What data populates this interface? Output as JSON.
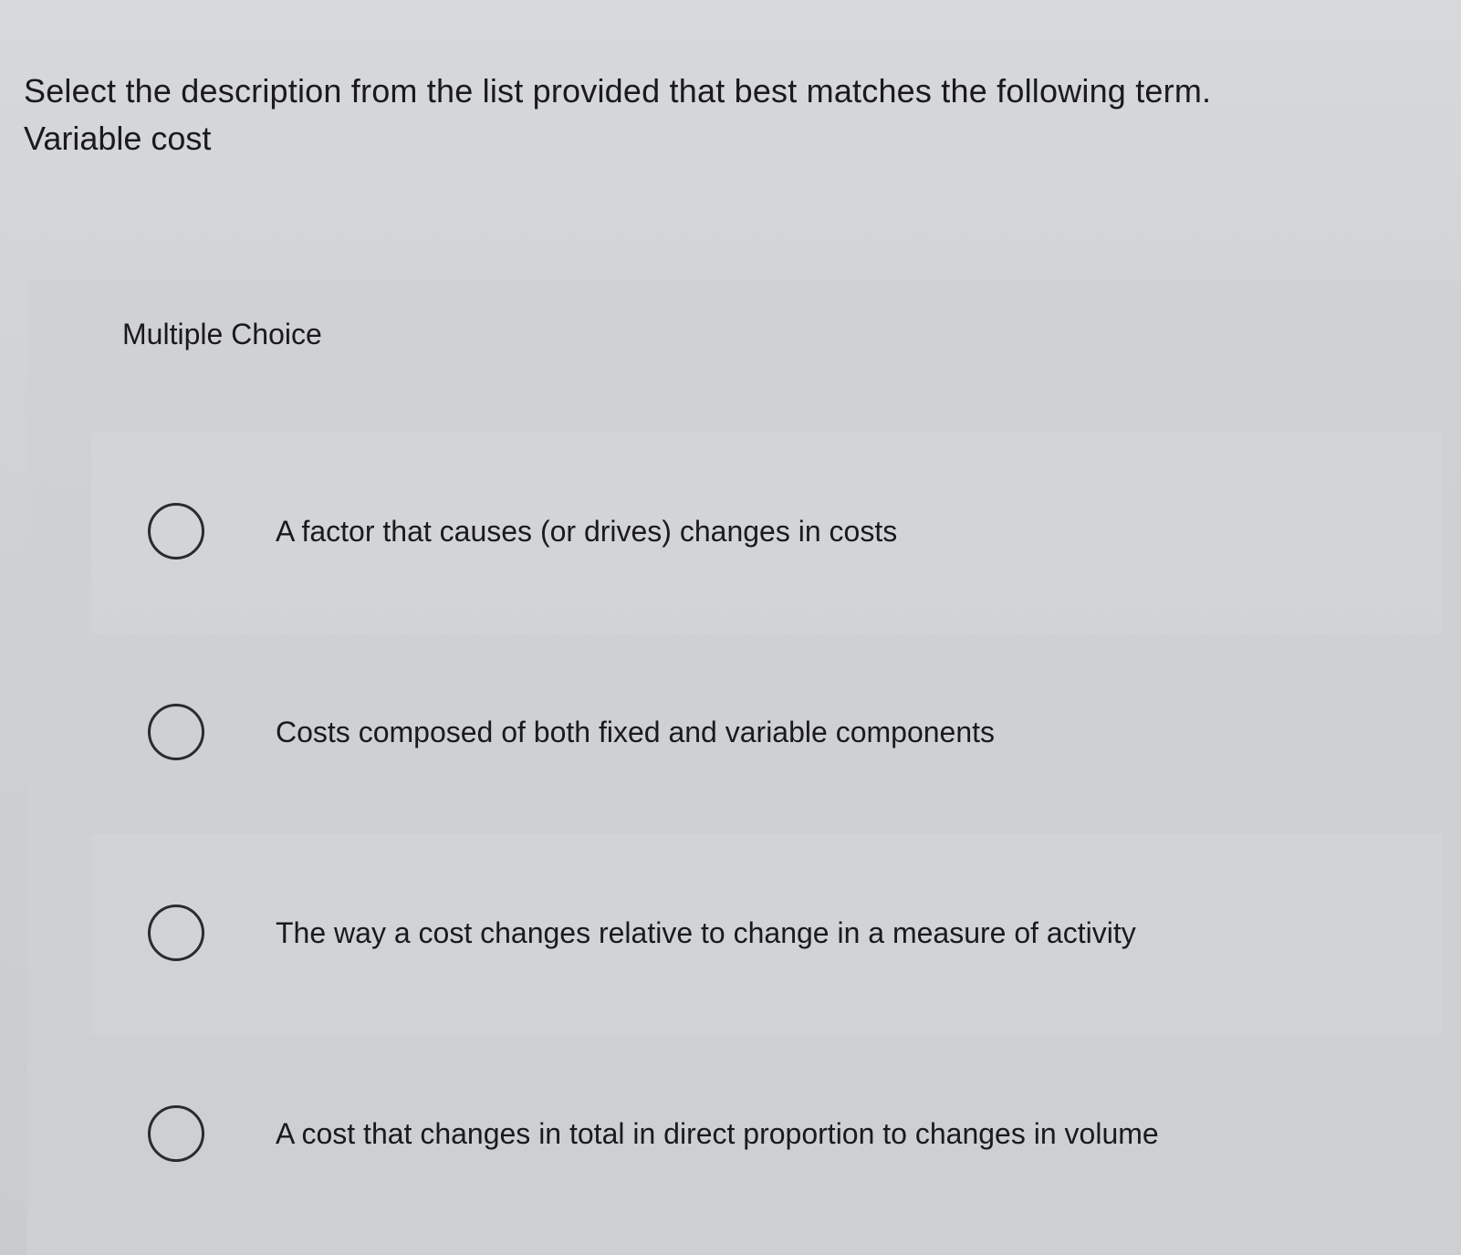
{
  "question": {
    "prompt": "Select the description from the list provided that best matches the following term.",
    "term": "Variable cost"
  },
  "panel": {
    "label": "Multiple Choice"
  },
  "options": [
    {
      "text": "A factor that causes (or drives) changes in costs",
      "selected": false
    },
    {
      "text": "Costs composed of both fixed and variable components",
      "selected": false
    },
    {
      "text": "The way a cost changes relative to change in a measure of activity",
      "selected": false
    },
    {
      "text": "A cost that changes in total in direct proportion to changes in volume",
      "selected": false
    }
  ]
}
